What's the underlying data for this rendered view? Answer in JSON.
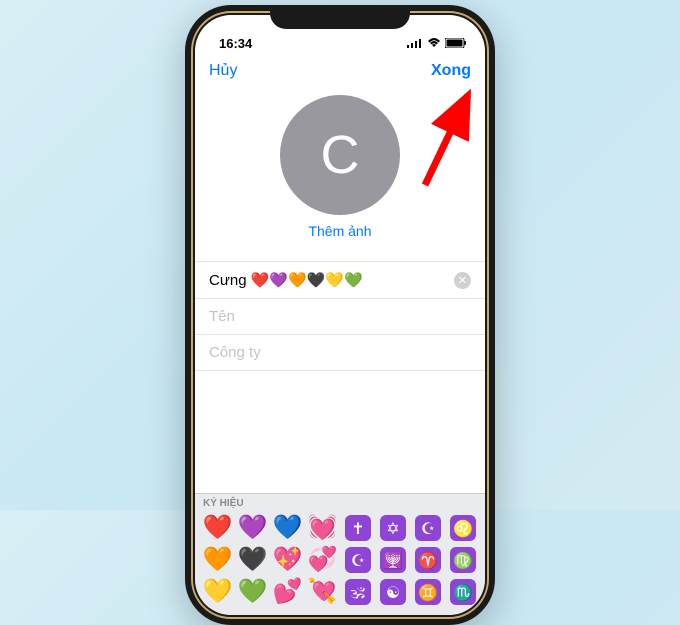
{
  "status_bar": {
    "time": "16:34",
    "signal_icon": "signal-icon",
    "wifi_icon": "wifi-icon",
    "battery_icon": "battery-icon"
  },
  "nav": {
    "cancel": "Hủy",
    "done": "Xong"
  },
  "avatar": {
    "initial": "C",
    "add_photo": "Thêm ảnh"
  },
  "fields": {
    "name_value": "Cưng ❤️💜🧡🖤💛💚",
    "last_name_placeholder": "Tên",
    "company_placeholder": "Công ty"
  },
  "keyboard": {
    "section_label": "KÝ HIỆU",
    "rows": [
      [
        "❤️",
        "💜",
        "💙",
        "💓",
        "✝️",
        "✡️",
        "☪️",
        "♌"
      ],
      [
        "🧡",
        "🖤",
        "💖",
        "💞",
        "☪️",
        "🕎",
        "♈",
        "♍"
      ],
      [
        "💛",
        "💚",
        "💕",
        "💘",
        "🕉️",
        "☯️",
        "♊",
        "♏"
      ]
    ]
  },
  "colors": {
    "accent": "#007aff",
    "annotation": "#ff0000"
  }
}
